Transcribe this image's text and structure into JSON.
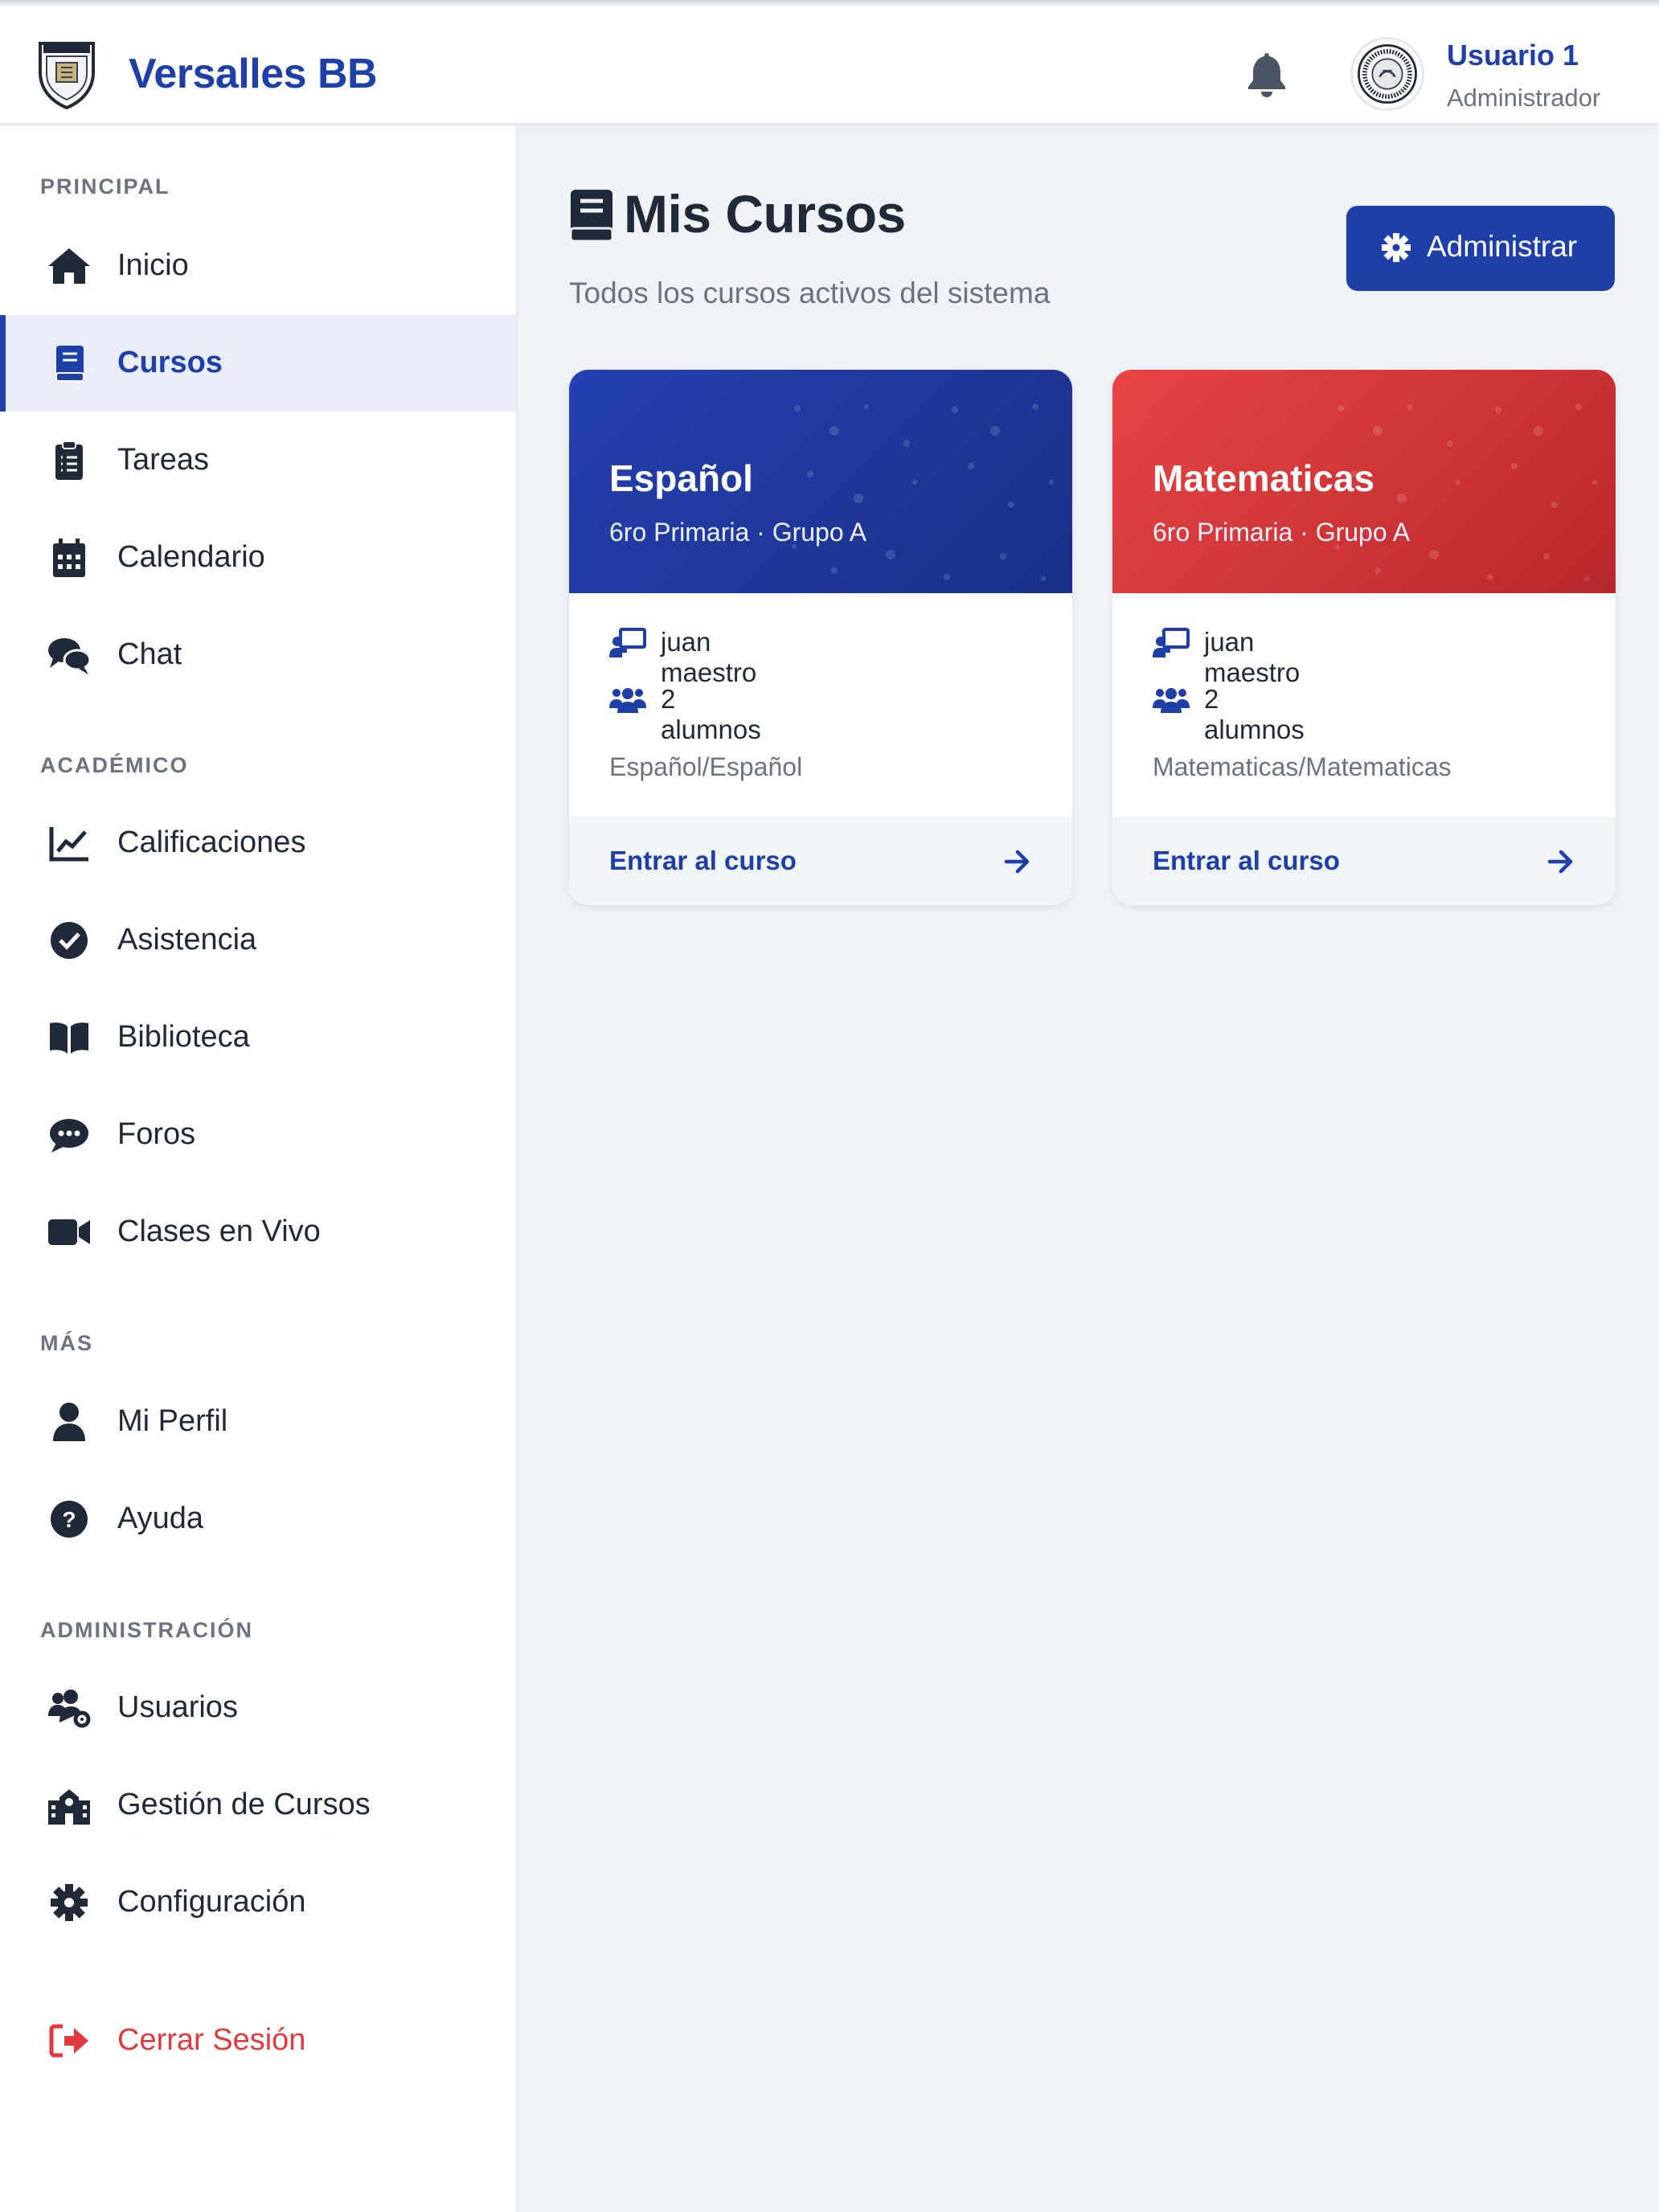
{
  "header": {
    "brand": "Versalles BB",
    "user_name": "Usuario 1",
    "user_role": "Administrador",
    "logo_icon": "school-crest-logo",
    "notification_icon": "bell-icon",
    "avatar_icon": "user-avatar-seal"
  },
  "sidebar": {
    "sections": [
      {
        "title": "PRINCIPAL",
        "items": [
          {
            "label": "Inicio",
            "icon": "home-icon"
          },
          {
            "label": "Cursos",
            "icon": "book-icon",
            "active": true
          },
          {
            "label": "Tareas",
            "icon": "clipboard-icon"
          },
          {
            "label": "Calendario",
            "icon": "calendar-icon"
          },
          {
            "label": "Chat",
            "icon": "comments-icon"
          }
        ]
      },
      {
        "title": "ACADÉMICO",
        "items": [
          {
            "label": "Calificaciones",
            "icon": "chart-line-icon"
          },
          {
            "label": "Asistencia",
            "icon": "check-circle-icon"
          },
          {
            "label": "Biblioteca",
            "icon": "open-book-icon"
          },
          {
            "label": "Foros",
            "icon": "comment-dots-icon"
          },
          {
            "label": "Clases en Vivo",
            "icon": "video-icon"
          }
        ]
      },
      {
        "title": "MÁS",
        "items": [
          {
            "label": "Mi Perfil",
            "icon": "user-icon"
          },
          {
            "label": "Ayuda",
            "icon": "question-circle-icon"
          }
        ]
      },
      {
        "title": "ADMINISTRACIÓN",
        "items": [
          {
            "label": "Usuarios",
            "icon": "users-cog-icon"
          },
          {
            "label": "Gestión de Cursos",
            "icon": "school-icon"
          },
          {
            "label": "Configuración",
            "icon": "cog-icon"
          }
        ]
      }
    ],
    "logout": {
      "label": "Cerrar Sesión",
      "icon": "sign-out-icon"
    }
  },
  "main": {
    "title": "Mis Cursos",
    "title_icon": "book-icon",
    "subtitle": "Todos los cursos activos del sistema",
    "admin_button": "Administrar",
    "admin_icon": "cog-icon",
    "courses": [
      {
        "name": "Español",
        "group": "6ro Primaria · Grupo A",
        "teacher": "juan maestro",
        "students": "2 alumnos",
        "subject": "Español/Español",
        "action": "Entrar al curso",
        "color_from": "#2541b2",
        "color_to": "#1a2f86"
      },
      {
        "name": "Matematicas",
        "group": "6ro Primaria · Grupo A",
        "teacher": "juan maestro",
        "students": "2 alumnos",
        "subject": "Matematicas/Matematicas",
        "action": "Entrar al curso",
        "color_from": "#e84444",
        "color_to": "#b8282c"
      }
    ]
  },
  "colors": {
    "accent": "#1f3fa8",
    "danger": "#e0393e",
    "background": "#eff3f7"
  }
}
